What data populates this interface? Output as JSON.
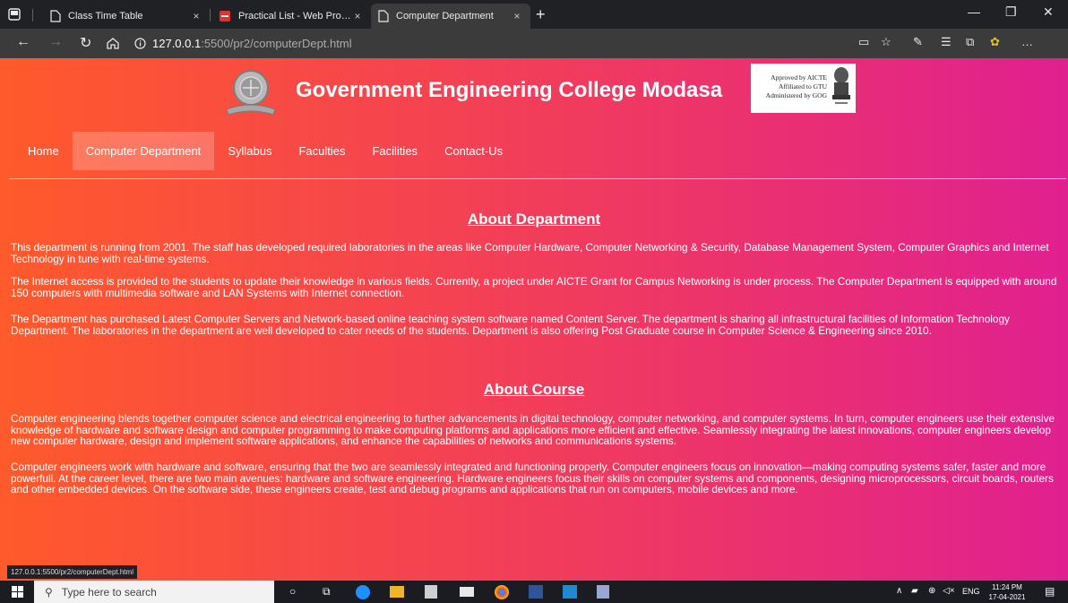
{
  "browser": {
    "tabs": [
      {
        "title": "Class Time Table",
        "close": "×"
      },
      {
        "title": "Practical List - Web Programming",
        "close": "×"
      },
      {
        "title": "Computer Department",
        "close": "×"
      }
    ],
    "new_tab": "+",
    "url_host": "127.0.0.1",
    "url_path": ":5500/pr2/computerDept.html",
    "status_url": "127.0.0.1:5500/pr2/computerDept.html"
  },
  "header": {
    "title": "Government Engineering College Modasa",
    "approval_lines": [
      "Approved by AICTE",
      "Affiliated to GTU",
      "Administered by GOG"
    ]
  },
  "nav": {
    "items": [
      {
        "label": "Home"
      },
      {
        "label": "Computer Department"
      },
      {
        "label": "Syllabus"
      },
      {
        "label": "Faculties"
      },
      {
        "label": "Facilities"
      },
      {
        "label": "Contact-Us"
      }
    ],
    "active": "Computer Department"
  },
  "about_department": {
    "title": "About Department",
    "paragraphs": [
      "This department is running from 2001. The staff has developed required laboratories in the areas like Computer Hardware, Computer Networking & Security, Database Management System, Computer Graphics and Internet Technology in tune with real-time systems.",
      "The Internet access is provided to the students to update their knowledge in various fields. Currently, a project under AICTE Grant for Campus Networking is under process. The Computer Department is equipped with around 150 computers with multimedia software and LAN Systems with Internet connection.",
      "The Department has purchased Latest Computer Servers and Network-based online teaching system software named Content Server. The department is sharing all infrastructural facilities of Information Technology Department. The laboratories in the department are well developed to cater needs of the students. Department is also offering Post Graduate course in Computer Science & Engineering since 2010."
    ]
  },
  "about_course": {
    "title": "About Course",
    "paragraphs": [
      "Computer engineering blends together computer science and electrical engineering to further advancements in digital technology, computer networking, and computer systems. In turn, computer engineers use their extensive knowledge of hardware and software design and computer programming to make computing platforms and applications more efficient and effective. Seamlessly integrating the latest innovations, computer engineers develop new computer hardware, design and implement software applications, and enhance the capabilities of networks and communications systems.",
      "Computer engineers work with hardware and software, ensuring that the two are seamlessly integrated and functioning properly. Computer engineers focus on innovation—making computing systems safer, faster and more powerfull. At the career level, there are two main avenues: hardware and software engineering. Hardware engineers focus their skills on computer systems and components, designing microprocessors, circuit boards, routers and other embedded devices. On the software side, these engineers create, test and debug programs and applications that run on computers, mobile devices and more."
    ]
  },
  "taskbar": {
    "search_placeholder": "Type here to search",
    "language": "ENG",
    "time": "11:24 PM",
    "date": "17-04-2021"
  },
  "colors": {
    "gradient_start": "#ff5a2b",
    "gradient_mid": "#f23d5a",
    "gradient_end": "#e0208f",
    "browser_dark": "#202124",
    "toolbar": "#3b3b3b"
  }
}
